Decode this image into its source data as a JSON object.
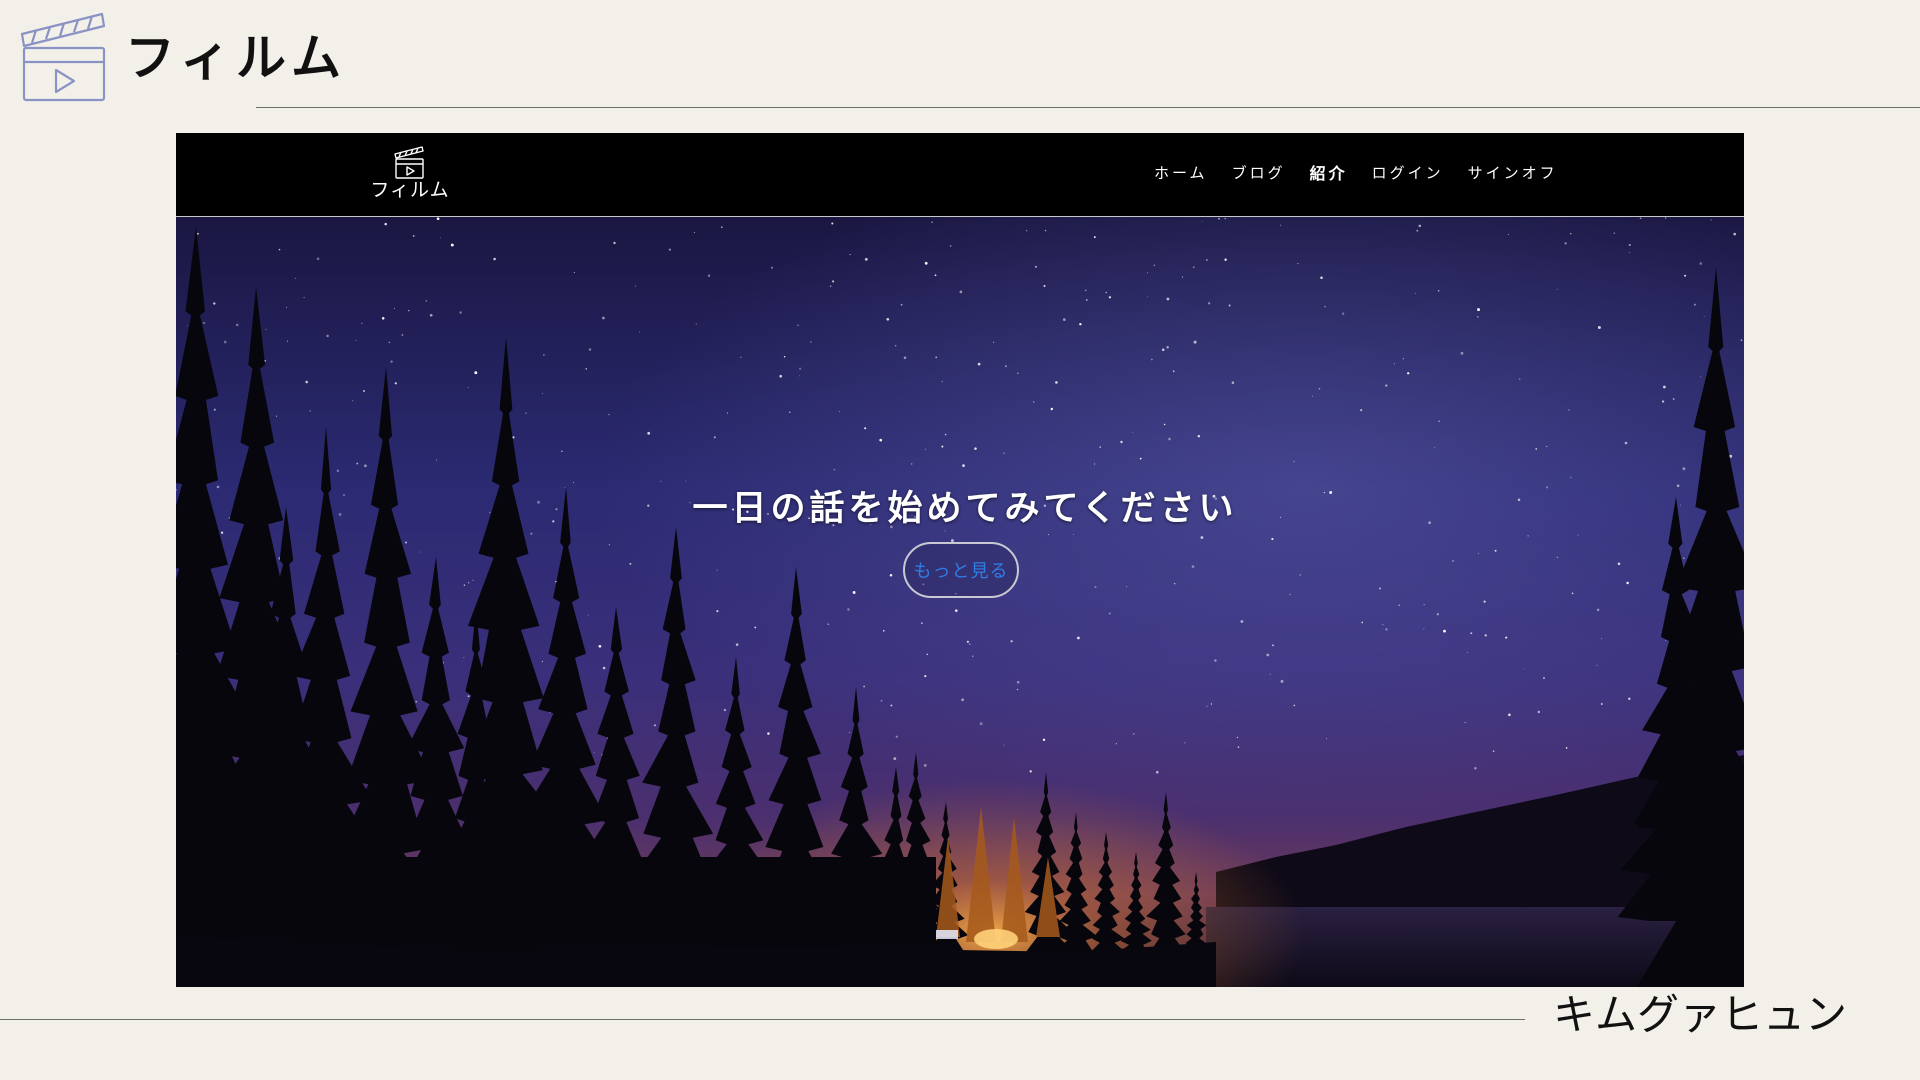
{
  "slide": {
    "title": "フィルム",
    "author": "キムグァヒュン"
  },
  "site": {
    "logo_text": "フィルム",
    "nav": [
      {
        "label": "ホーム"
      },
      {
        "label": "ブログ"
      },
      {
        "label": "紹介"
      },
      {
        "label": "ログイン"
      },
      {
        "label": "サインオフ"
      }
    ],
    "hero": {
      "heading": "一日の話を始めてみてください",
      "button_label": "もっと見る"
    }
  },
  "icons": {
    "slide_icon": "clapperboard-icon",
    "logo_icon": "clapperboard-icon"
  },
  "colors": {
    "slide_background": "#f3f0ea",
    "nav_background": "#000000",
    "button_text": "#2f7de6",
    "icon_stroke": "#8a94c4"
  }
}
